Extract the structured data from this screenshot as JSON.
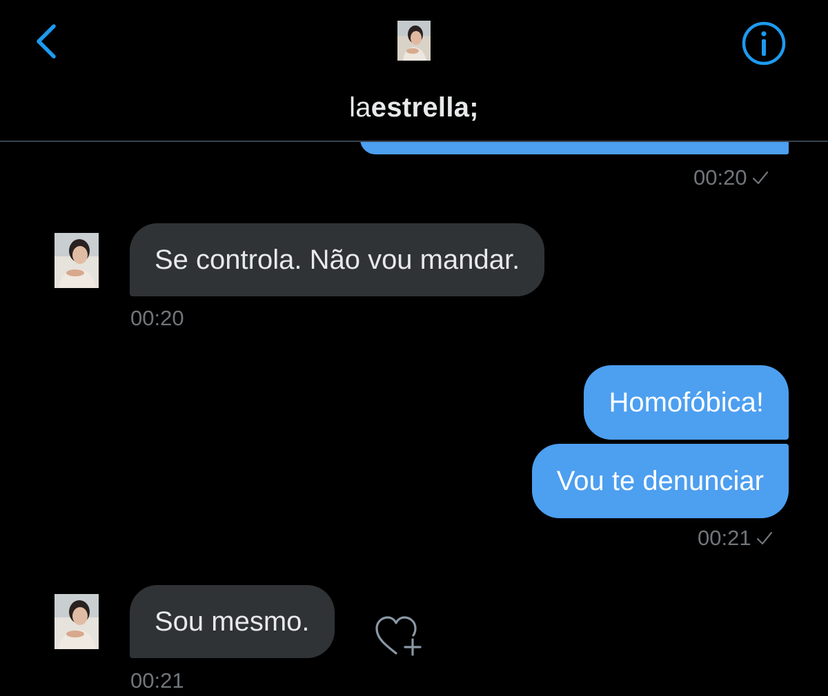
{
  "header": {
    "contact_name_prefix": "la",
    "contact_name_bold": "estrella;"
  },
  "messages": [
    {
      "direction": "out",
      "text": "",
      "time": "00:20",
      "status": "sent"
    },
    {
      "direction": "in",
      "text": "Se controla. Não vou mandar.",
      "time": "00:20"
    },
    {
      "direction": "out",
      "text": "Homofóbica!"
    },
    {
      "direction": "out",
      "text": "Vou te denunciar",
      "time": "00:21",
      "status": "sent"
    },
    {
      "direction": "in",
      "text": "Sou mesmo.",
      "time": "00:21"
    }
  ],
  "colors": {
    "background": "#000000",
    "outgoing_bubble": "#4d9ff0",
    "incoming_bubble": "#2f3336",
    "accent": "#1d9bf0",
    "muted_text": "#71767b"
  },
  "icons": {
    "back": "chevron-left-icon",
    "info": "info-icon",
    "check": "check-icon",
    "react": "heart-plus-icon"
  }
}
